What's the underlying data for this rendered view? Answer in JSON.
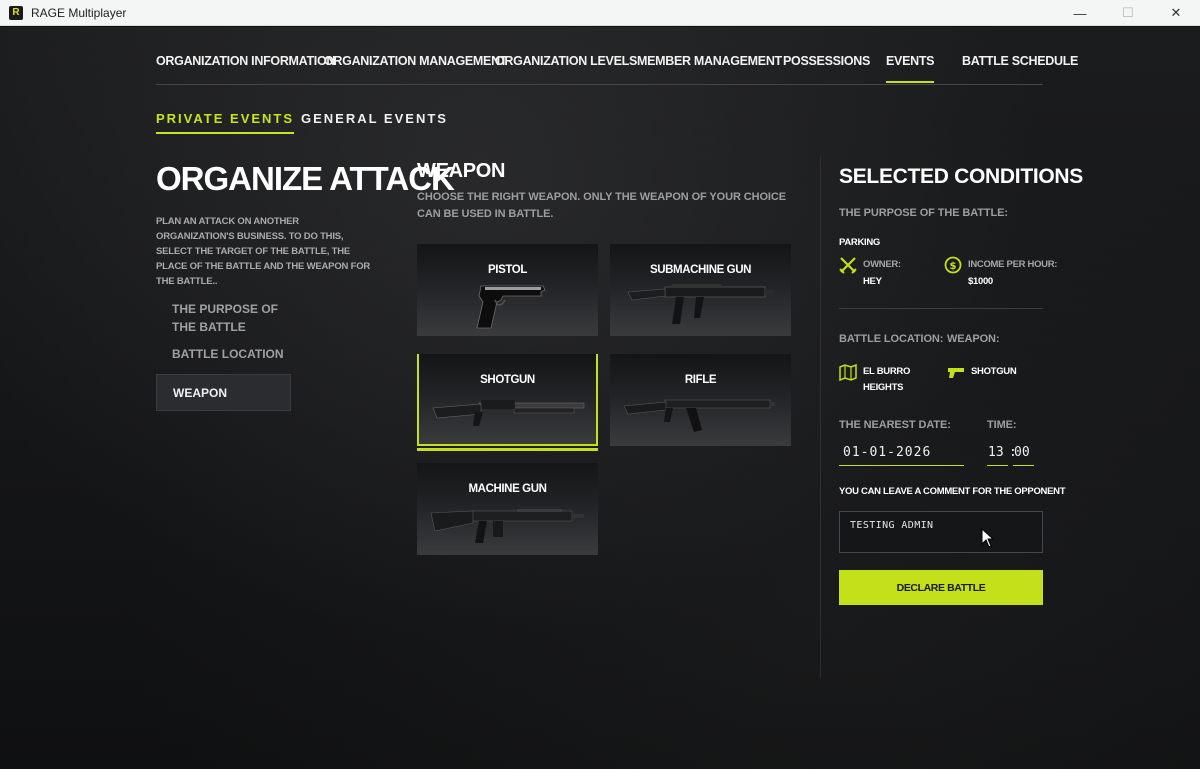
{
  "window": {
    "app_logo_letter": "R",
    "title": "RAGE Multiplayer",
    "minimize": "—",
    "maximize": "☐",
    "close": "✕"
  },
  "colors": {
    "accent": "#c3e01a",
    "background": "#111214"
  },
  "topnav": {
    "tabs": [
      {
        "label": "ORGANIZATION INFORMATION"
      },
      {
        "label": "ORGANIZATION MANAGEMENT"
      },
      {
        "label": "ORGANIZATION LEVELS"
      },
      {
        "label": "MEMBER MANAGEMENT"
      },
      {
        "label": "POSSESSIONS"
      },
      {
        "label": "EVENTS",
        "active": true
      },
      {
        "label": "BATTLE SCHEDULE"
      }
    ]
  },
  "subtabs": [
    {
      "label": "PRIVATE EVENTS",
      "active": true
    },
    {
      "label": "GENERAL EVENTS"
    }
  ],
  "left": {
    "title": "ORGANIZE ATTACK",
    "description": "PLAN AN ATTACK ON ANOTHER ORGANIZATION'S BUSINESS. TO DO THIS, SELECT THE TARGET OF THE BATTLE, THE PLACE OF THE BATTLE AND THE WEAPON FOR THE BATTLE..",
    "steps": [
      {
        "label": "THE PURPOSE OF THE BATTLE"
      },
      {
        "label": "BATTLE LOCATION"
      },
      {
        "label": "WEAPON",
        "active": true
      }
    ]
  },
  "weapon": {
    "title": "WEAPON",
    "description": "CHOOSE THE RIGHT WEAPON. ONLY THE WEAPON OF YOUR CHOICE CAN BE USED IN BATTLE.",
    "cards": [
      {
        "label": "PISTOL",
        "icon": "pistol-icon"
      },
      {
        "label": "SUBMACHINE GUN",
        "icon": "smg-icon"
      },
      {
        "label": "SHOTGUN",
        "icon": "shotgun-icon",
        "selected": true
      },
      {
        "label": "RIFLE",
        "icon": "rifle-icon"
      },
      {
        "label": "MACHINE GUN",
        "icon": "machine-gun-icon"
      }
    ]
  },
  "conditions": {
    "title": "SELECTED CONDITIONS",
    "purpose_label": "THE PURPOSE OF THE BATTLE:",
    "target_name": "PARKING",
    "owner_label": "OWNER:",
    "owner_value": "HEY",
    "income_label": "INCOME PER HOUR:",
    "income_value": "$1000",
    "location_label": "BATTLE LOCATION:",
    "location_value_1": "EL BURRO",
    "location_value_2": "HEIGHTS",
    "weapon_label": "WEAPON:",
    "weapon_value": "SHOTGUN",
    "date_label": "THE NEAREST DATE:",
    "date_value": "01-01-2026",
    "time_label": "TIME:",
    "time_hours": "13",
    "time_minutes": "00",
    "time_separator": ":",
    "comment_label": "YOU CAN LEAVE A COMMENT FOR THE OPPONENT",
    "comment_value": "TESTING ADMIN",
    "declare_button": "DECLARE BATTLE"
  }
}
